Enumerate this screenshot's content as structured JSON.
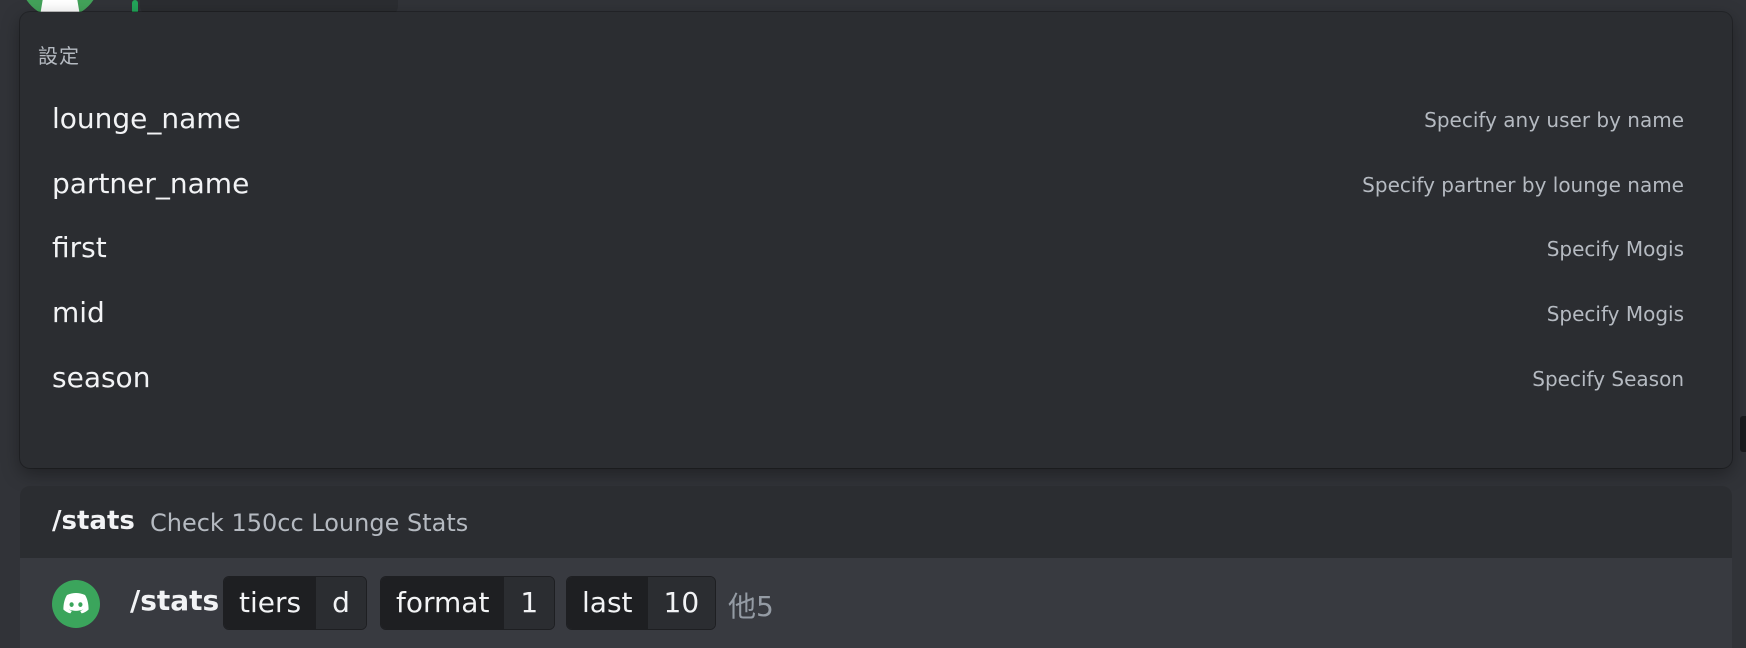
{
  "options_popup": {
    "title": "設定",
    "options": [
      {
        "name": "lounge_name",
        "description": "Specify any user by name"
      },
      {
        "name": "partner_name",
        "description": "Specify partner by lounge name"
      },
      {
        "name": "first",
        "description": "Specify Mogis"
      },
      {
        "name": "mid",
        "description": "Specify Mogis"
      },
      {
        "name": "season",
        "description": "Specify Season"
      }
    ]
  },
  "command_header": {
    "name": "/stats",
    "description": "Check 150cc Lounge Stats"
  },
  "input_bar": {
    "bot_icon": "discord-logo-icon",
    "command": "/stats",
    "params": [
      {
        "key": "tiers",
        "value": "d"
      },
      {
        "key": "format",
        "value": "1"
      },
      {
        "key": "last",
        "value": "10"
      }
    ],
    "more_label": "他5"
  },
  "colors": {
    "background": "#313338",
    "panel": "#2b2d31",
    "input": "#383a40",
    "accent_green": "#3ba55c"
  }
}
